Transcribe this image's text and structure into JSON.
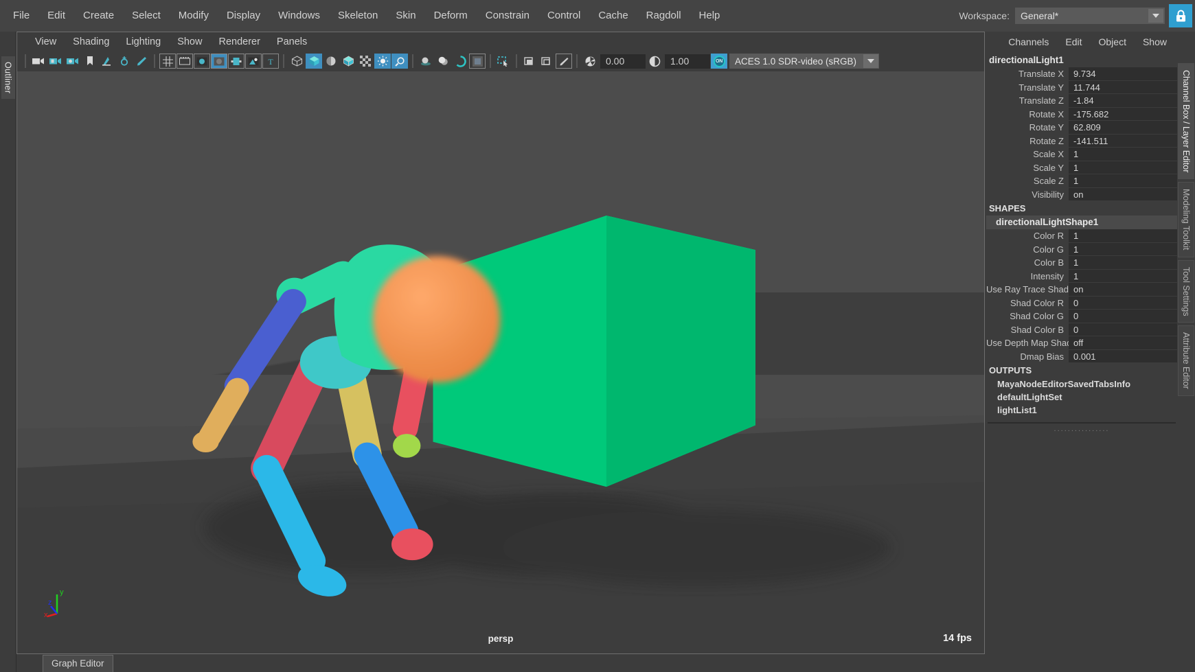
{
  "main_menu": {
    "items": [
      {
        "label": "File"
      },
      {
        "label": "Edit"
      },
      {
        "label": "Create"
      },
      {
        "label": "Select"
      },
      {
        "label": "Modify"
      },
      {
        "label": "Display"
      },
      {
        "label": "Windows"
      },
      {
        "label": "Skeleton"
      },
      {
        "label": "Skin"
      },
      {
        "label": "Deform"
      },
      {
        "label": "Constrain"
      },
      {
        "label": "Control"
      },
      {
        "label": "Cache"
      },
      {
        "label": "Ragdoll"
      },
      {
        "label": "Help"
      }
    ]
  },
  "workspace": {
    "label": "Workspace:",
    "value": "General*",
    "dropdown_icon": "chevron-down-icon",
    "lock_icon": "lock-icon"
  },
  "left_rail": {
    "tabs": [
      {
        "label": "Outliner",
        "active": true
      }
    ]
  },
  "panel_menu": {
    "items": [
      {
        "label": "View"
      },
      {
        "label": "Shading"
      },
      {
        "label": "Lighting"
      },
      {
        "label": "Show"
      },
      {
        "label": "Renderer"
      },
      {
        "label": "Panels"
      }
    ]
  },
  "panel_toolbar": {
    "icons": [
      {
        "name": "select-camera-icon",
        "active": false
      },
      {
        "name": "camera-attributes-icon",
        "active": false
      },
      {
        "name": "camera-bookmark-settings-icon",
        "active": false
      },
      {
        "name": "bookmark-icon",
        "active": false
      },
      {
        "name": "image-plane-icon",
        "active": false
      },
      {
        "name": "two-d-pan-zoom-icon",
        "active": false
      },
      {
        "name": "paint-effects-icon",
        "active": false
      },
      {
        "name": "grid-icon",
        "active": false
      },
      {
        "name": "film-gate-icon",
        "active": false
      },
      {
        "name": "resolution-gate-icon",
        "active": false
      },
      {
        "name": "gate-mask-icon",
        "active": true
      },
      {
        "name": "field-chart-icon",
        "active": false
      },
      {
        "name": "safe-action-icon",
        "active": false
      },
      {
        "name": "safe-title-icon",
        "active": false
      },
      {
        "name": "wireframe-icon",
        "active": false
      },
      {
        "name": "smooth-shade-all-icon",
        "active": true
      },
      {
        "name": "shade-flat-icon",
        "active": false
      },
      {
        "name": "wireframe-on-shaded-icon",
        "active": false
      },
      {
        "name": "x-ray-icon",
        "active": false
      },
      {
        "name": "use-default-lighting-icon",
        "active": true
      },
      {
        "name": "use-all-lights-icon",
        "active": true
      },
      {
        "name": "shadows-icon",
        "active": false
      },
      {
        "name": "ambient-occlusion-icon",
        "active": false
      },
      {
        "name": "motion-blur-icon",
        "active": false
      },
      {
        "name": "multisample-anti-aliasing-icon",
        "active": false
      },
      {
        "name": "isolate-select-icon",
        "active": false
      },
      {
        "name": "xray-joints-icon",
        "active": false
      },
      {
        "name": "xray-active-components-icon",
        "active": false
      },
      {
        "name": "exposure-reset-icon",
        "active": false
      }
    ],
    "exposure_icon": "aperture-icon",
    "exposure_value": "0.00",
    "gamma_icon": "contrast-icon",
    "gamma_value": "1.00",
    "color_management_toggle": "ON",
    "color_space": "ACES 1.0 SDR-video (sRGB)",
    "color_space_arrow": "chevron-down-icon"
  },
  "viewport": {
    "camera_label": "persp",
    "fps_label": "14 fps",
    "axis_gizmo": {
      "x_label": "x",
      "x_color": "#e02020",
      "y_label": "y",
      "y_color": "#20d020",
      "z_label": "z",
      "z_color": "#2030f0"
    },
    "scene": {
      "ground_color": "#3e3e3e",
      "background_color": "#4c4c4c",
      "hex_prism_color": "#00c97a",
      "character_parts": [
        {
          "name": "head",
          "color": "#f09050"
        },
        {
          "name": "torso",
          "color": "#25d6a0"
        },
        {
          "name": "hips",
          "color": "#3fc8c8"
        },
        {
          "name": "left-upper-arm",
          "color": "#35d6a0"
        },
        {
          "name": "left-forearm",
          "color": "#4a5fd0"
        },
        {
          "name": "left-hand",
          "color": "#e8b860"
        },
        {
          "name": "right-upper-arm",
          "color": "#e8b060"
        },
        {
          "name": "right-forearm",
          "color": "#e8505f"
        },
        {
          "name": "right-hand",
          "color": "#a8d84a"
        },
        {
          "name": "left-thigh",
          "color": "#d9455c"
        },
        {
          "name": "left-shin",
          "color": "#2db8e8"
        },
        {
          "name": "left-foot",
          "color": "#2db8e8"
        },
        {
          "name": "right-thigh",
          "color": "#d8c060"
        },
        {
          "name": "right-shin",
          "color": "#2d8fe8"
        },
        {
          "name": "right-foot",
          "color": "#e8505f"
        }
      ]
    }
  },
  "bottom": {
    "graph_editor_tab": "Graph Editor"
  },
  "channel_box": {
    "menu": [
      {
        "label": "Channels"
      },
      {
        "label": "Edit"
      },
      {
        "label": "Object"
      },
      {
        "label": "Show"
      }
    ],
    "node_name": "directionalLight1",
    "transform_attrs": [
      {
        "label": "Translate X",
        "value": "9.734"
      },
      {
        "label": "Translate Y",
        "value": "11.744"
      },
      {
        "label": "Translate Z",
        "value": "-1.84"
      },
      {
        "label": "Rotate X",
        "value": "-175.682"
      },
      {
        "label": "Rotate Y",
        "value": "62.809"
      },
      {
        "label": "Rotate Z",
        "value": "-141.511"
      },
      {
        "label": "Scale X",
        "value": "1"
      },
      {
        "label": "Scale Y",
        "value": "1"
      },
      {
        "label": "Scale Z",
        "value": "1"
      },
      {
        "label": "Visibility",
        "value": "on"
      }
    ],
    "shapes_header": "SHAPES",
    "shape_name": "directionalLightShape1",
    "shape_attrs": [
      {
        "label": "Color R",
        "value": "1"
      },
      {
        "label": "Color G",
        "value": "1"
      },
      {
        "label": "Color B",
        "value": "1"
      },
      {
        "label": "Intensity",
        "value": "1"
      },
      {
        "label": "Use Ray Trace Shadows",
        "value": "on"
      },
      {
        "label": "Shad Color R",
        "value": "0"
      },
      {
        "label": "Shad Color G",
        "value": "0"
      },
      {
        "label": "Shad Color B",
        "value": "0"
      },
      {
        "label": "Use Depth Map Shadows",
        "value": "off"
      },
      {
        "label": "Dmap Bias",
        "value": "0.001"
      }
    ],
    "outputs_header": "OUTPUTS",
    "outputs": [
      {
        "label": "MayaNodeEditorSavedTabsInfo"
      },
      {
        "label": "defaultLightSet"
      },
      {
        "label": "lightList1"
      }
    ],
    "resize_dots": "................"
  },
  "right_rail": {
    "tabs": [
      {
        "label": "Channel Box / Layer Editor",
        "active": true
      },
      {
        "label": "Modeling Toolkit",
        "active": false
      },
      {
        "label": "Tool Settings",
        "active": false
      },
      {
        "label": "Attribute Editor",
        "active": false
      }
    ]
  },
  "colors": {
    "accent": "#3f9fd0",
    "panel_bg": "#3c3c3c",
    "menu_bg": "#444444",
    "viewport_bg": "#4c4c4c"
  }
}
